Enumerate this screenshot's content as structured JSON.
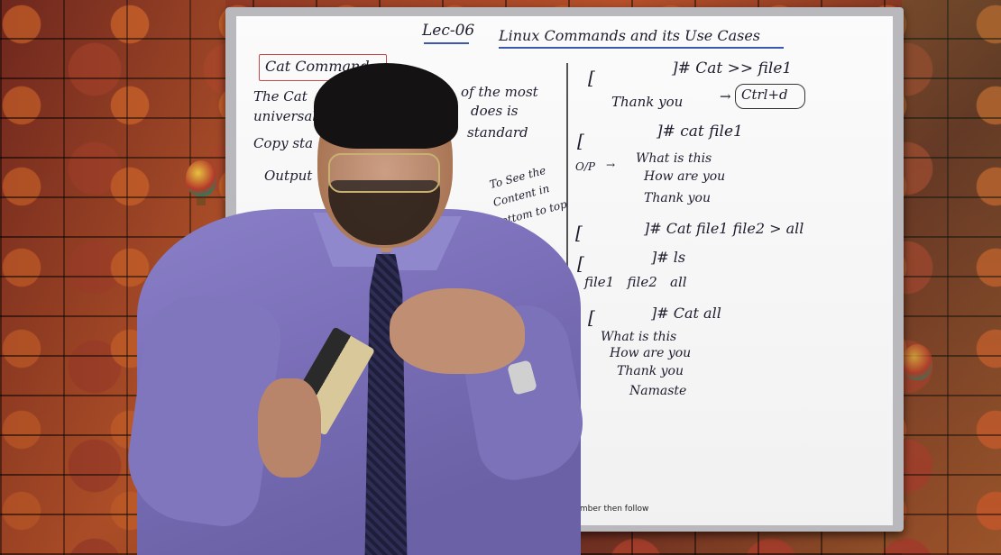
{
  "board": {
    "lecture": "Lec-06",
    "title": "Linux Commands and its Use Cases",
    "left": {
      "heading": "Cat Command",
      "line1": "The Cat",
      "line1b": "of the most",
      "line2": "universal",
      "line2b": "does is",
      "line3": "Copy sta",
      "line3b": "standard",
      "line4": "Output",
      "note1": "To See the",
      "note2": "Content in",
      "note3": "Bottom to top"
    },
    "right": {
      "l1_bracket": "[",
      "l1_cmd": "]# Cat >> file1",
      "l1_thanks": "Thank you",
      "l1_key": "Ctrl+d",
      "l2_bracket": "[",
      "l2_cmd": "]# cat file1",
      "op_label": "O/P",
      "op_1": "What is this",
      "op_2": "How are you",
      "op_3": "Thank you",
      "l3_bracket": "[",
      "l3_cmd": "]# Cat file1 file2 > all",
      "l4_bracket": "[",
      "l4_cmd": "]# ls",
      "ls_out": "file1   file2   all",
      "l5_bracket": "[",
      "l5_cmd": "]# Cat all",
      "all_1": "What is this",
      "all_2": "How are you",
      "all_3": "Thank you",
      "all_4": "Namaste"
    }
  },
  "caption": "to remember and if you remember then follow"
}
